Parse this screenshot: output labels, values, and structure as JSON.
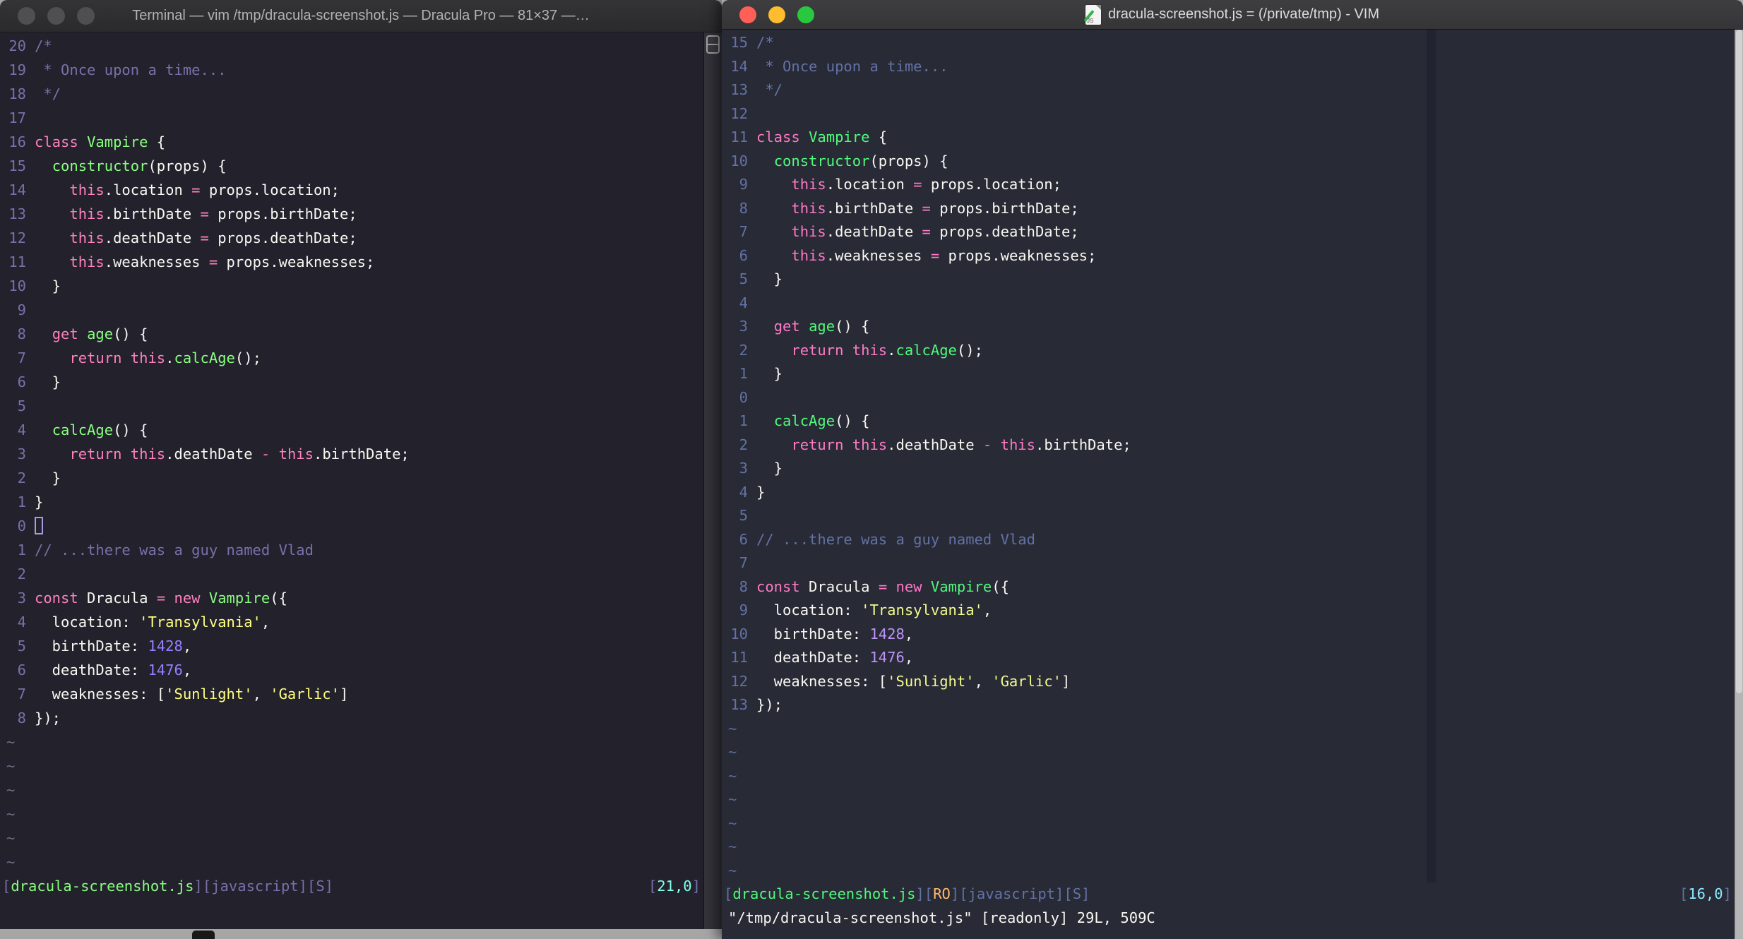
{
  "desktop": {
    "bg": "#a6a6a6"
  },
  "left_window": {
    "titlebar": {
      "title": "Terminal — vim /tmp/dracula-screenshot.js — Dracula Pro — 81×37 —…",
      "bg": "#2c2c2e",
      "text_color": "#b2b2b2",
      "lights": [
        "#4f4f52",
        "#4f4f52",
        "#4f4f52"
      ]
    },
    "theme": {
      "bg": "#22212c",
      "fg": "#f8f8f2",
      "comment": "#7970a9",
      "pink": "#ff80bf",
      "green": "#8aff80",
      "yellow": "#ffff80",
      "purple": "#9580ff",
      "cyan": "#80ffea",
      "orange": "#ffca80",
      "linenr": "#7970a9",
      "tilde": "#6f6a87",
      "cursor": "#a79de4"
    },
    "cursor_row": 21,
    "tildes": 6,
    "lines": [
      {
        "n": "20",
        "s": [
          [
            "/*",
            "comment"
          ]
        ]
      },
      {
        "n": "19",
        "s": [
          [
            " * Once upon a time...",
            "comment"
          ]
        ]
      },
      {
        "n": "18",
        "s": [
          [
            " */",
            "comment"
          ]
        ]
      },
      {
        "n": "17",
        "s": []
      },
      {
        "n": "16",
        "s": [
          [
            "class ",
            "pink"
          ],
          [
            "Vampire",
            "green"
          ],
          [
            " {",
            "fg"
          ]
        ]
      },
      {
        "n": "15",
        "s": [
          [
            "  ",
            "fg"
          ],
          [
            "constructor",
            "green"
          ],
          [
            "(props) {",
            "fg"
          ]
        ]
      },
      {
        "n": "14",
        "s": [
          [
            "    ",
            "fg"
          ],
          [
            "this",
            "pink"
          ],
          [
            ".location ",
            "fg"
          ],
          [
            "=",
            "pink"
          ],
          [
            " props.location;",
            "fg"
          ]
        ]
      },
      {
        "n": "13",
        "s": [
          [
            "    ",
            "fg"
          ],
          [
            "this",
            "pink"
          ],
          [
            ".birthDate ",
            "fg"
          ],
          [
            "=",
            "pink"
          ],
          [
            " props.birthDate;",
            "fg"
          ]
        ]
      },
      {
        "n": "12",
        "s": [
          [
            "    ",
            "fg"
          ],
          [
            "this",
            "pink"
          ],
          [
            ".deathDate ",
            "fg"
          ],
          [
            "=",
            "pink"
          ],
          [
            " props.deathDate;",
            "fg"
          ]
        ]
      },
      {
        "n": "11",
        "s": [
          [
            "    ",
            "fg"
          ],
          [
            "this",
            "pink"
          ],
          [
            ".weaknesses ",
            "fg"
          ],
          [
            "=",
            "pink"
          ],
          [
            " props.weaknesses;",
            "fg"
          ]
        ]
      },
      {
        "n": "10",
        "s": [
          [
            "  }",
            "fg"
          ]
        ]
      },
      {
        "n": "9",
        "s": []
      },
      {
        "n": "8",
        "s": [
          [
            "  ",
            "fg"
          ],
          [
            "get",
            "pink"
          ],
          [
            " ",
            "fg"
          ],
          [
            "age",
            "green"
          ],
          [
            "() {",
            "fg"
          ]
        ]
      },
      {
        "n": "7",
        "s": [
          [
            "    ",
            "fg"
          ],
          [
            "return",
            "pink"
          ],
          [
            " ",
            "fg"
          ],
          [
            "this",
            "pink"
          ],
          [
            ".",
            "fg"
          ],
          [
            "calcAge",
            "green"
          ],
          [
            "();",
            "fg"
          ]
        ]
      },
      {
        "n": "6",
        "s": [
          [
            "  }",
            "fg"
          ]
        ]
      },
      {
        "n": "5",
        "s": []
      },
      {
        "n": "4",
        "s": [
          [
            "  ",
            "fg"
          ],
          [
            "calcAge",
            "green"
          ],
          [
            "() {",
            "fg"
          ]
        ]
      },
      {
        "n": "3",
        "s": [
          [
            "    ",
            "fg"
          ],
          [
            "return",
            "pink"
          ],
          [
            " ",
            "fg"
          ],
          [
            "this",
            "pink"
          ],
          [
            ".deathDate ",
            "fg"
          ],
          [
            "-",
            "pink"
          ],
          [
            " ",
            "fg"
          ],
          [
            "this",
            "pink"
          ],
          [
            ".birthDate;",
            "fg"
          ]
        ]
      },
      {
        "n": "2",
        "s": [
          [
            "  }",
            "fg"
          ]
        ]
      },
      {
        "n": "1",
        "s": [
          [
            "}",
            "fg"
          ]
        ]
      },
      {
        "n": "0",
        "s": []
      },
      {
        "n": "1",
        "s": [
          [
            "// ...there was a guy named Vlad",
            "comment"
          ]
        ]
      },
      {
        "n": "2",
        "s": []
      },
      {
        "n": "3",
        "s": [
          [
            "const",
            "pink"
          ],
          [
            " Dracula ",
            "fg"
          ],
          [
            "=",
            "pink"
          ],
          [
            " ",
            "fg"
          ],
          [
            "new",
            "pink"
          ],
          [
            " ",
            "fg"
          ],
          [
            "Vampire",
            "green"
          ],
          [
            "({",
            "fg"
          ]
        ]
      },
      {
        "n": "4",
        "s": [
          [
            "  location: ",
            "fg"
          ],
          [
            "'Transylvania'",
            "yellow"
          ],
          [
            ",",
            "fg"
          ]
        ]
      },
      {
        "n": "5",
        "s": [
          [
            "  birthDate: ",
            "fg"
          ],
          [
            "1428",
            "purple"
          ],
          [
            ",",
            "fg"
          ]
        ]
      },
      {
        "n": "6",
        "s": [
          [
            "  deathDate: ",
            "fg"
          ],
          [
            "1476",
            "purple"
          ],
          [
            ",",
            "fg"
          ]
        ]
      },
      {
        "n": "7",
        "s": [
          [
            "  weaknesses: [",
            "fg"
          ],
          [
            "'Sunlight'",
            "yellow"
          ],
          [
            ", ",
            "fg"
          ],
          [
            "'Garlic'",
            "yellow"
          ],
          [
            "]",
            "fg"
          ]
        ]
      },
      {
        "n": "8",
        "s": [
          [
            "});",
            "fg"
          ]
        ]
      }
    ],
    "status_left": [
      [
        "[",
        "comment"
      ],
      [
        "dracula-screenshot.js",
        "green"
      ],
      [
        "][",
        "comment"
      ],
      [
        "javascript",
        "comment"
      ],
      [
        "][",
        "comment"
      ],
      [
        "S",
        "comment"
      ],
      [
        "]",
        "comment"
      ]
    ],
    "ruler": [
      [
        "[",
        "comment"
      ],
      [
        "21,0",
        "cyan"
      ],
      [
        "]",
        "comment"
      ]
    ],
    "cmdline": ""
  },
  "right_window": {
    "titlebar": {
      "title": "dracula-screenshot.js = (/private/tmp) - VIM",
      "bg": "#38383a",
      "text_color": "#dcdcdc",
      "lights": [
        "#ff5f57",
        "#febc2e",
        "#28c840"
      ],
      "doc_icon_label": "JS"
    },
    "theme": {
      "bg": "#282a36",
      "fg": "#f8f8f2",
      "comment": "#6272a4",
      "pink": "#ff79c6",
      "green": "#50fa7b",
      "yellow": "#f1fa8c",
      "purple": "#bd93f9",
      "cyan": "#8be9fd",
      "orange": "#ffb86c",
      "linenr": "#6272a4",
      "tilde": "#5b6a9a",
      "cursor": "#f8f8f2"
    },
    "cursor_row": 16,
    "tildes": 7,
    "lines": [
      {
        "n": "15",
        "s": [
          [
            "/*",
            "comment"
          ]
        ]
      },
      {
        "n": "14",
        "s": [
          [
            " * Once upon a time...",
            "comment"
          ]
        ]
      },
      {
        "n": "13",
        "s": [
          [
            " */",
            "comment"
          ]
        ]
      },
      {
        "n": "12",
        "s": []
      },
      {
        "n": "11",
        "s": [
          [
            "class ",
            "pink"
          ],
          [
            "Vampire",
            "green"
          ],
          [
            " {",
            "fg"
          ]
        ]
      },
      {
        "n": "10",
        "s": [
          [
            "  ",
            "fg"
          ],
          [
            "constructor",
            "green"
          ],
          [
            "(props) {",
            "fg"
          ]
        ]
      },
      {
        "n": "9",
        "s": [
          [
            "    ",
            "fg"
          ],
          [
            "this",
            "pink"
          ],
          [
            ".location ",
            "fg"
          ],
          [
            "=",
            "pink"
          ],
          [
            " props.location;",
            "fg"
          ]
        ]
      },
      {
        "n": "8",
        "s": [
          [
            "    ",
            "fg"
          ],
          [
            "this",
            "pink"
          ],
          [
            ".birthDate ",
            "fg"
          ],
          [
            "=",
            "pink"
          ],
          [
            " props.birthDate;",
            "fg"
          ]
        ]
      },
      {
        "n": "7",
        "s": [
          [
            "    ",
            "fg"
          ],
          [
            "this",
            "pink"
          ],
          [
            ".deathDate ",
            "fg"
          ],
          [
            "=",
            "pink"
          ],
          [
            " props.deathDate;",
            "fg"
          ]
        ]
      },
      {
        "n": "6",
        "s": [
          [
            "    ",
            "fg"
          ],
          [
            "this",
            "pink"
          ],
          [
            ".weaknesses ",
            "fg"
          ],
          [
            "=",
            "pink"
          ],
          [
            " props.weaknesses;",
            "fg"
          ]
        ]
      },
      {
        "n": "5",
        "s": [
          [
            "  }",
            "fg"
          ]
        ]
      },
      {
        "n": "4",
        "s": []
      },
      {
        "n": "3",
        "s": [
          [
            "  ",
            "fg"
          ],
          [
            "get",
            "pink"
          ],
          [
            " ",
            "fg"
          ],
          [
            "age",
            "green"
          ],
          [
            "() {",
            "fg"
          ]
        ]
      },
      {
        "n": "2",
        "s": [
          [
            "    ",
            "fg"
          ],
          [
            "return",
            "pink"
          ],
          [
            " ",
            "fg"
          ],
          [
            "this",
            "pink"
          ],
          [
            ".",
            "fg"
          ],
          [
            "calcAge",
            "green"
          ],
          [
            "();",
            "fg"
          ]
        ]
      },
      {
        "n": "1",
        "s": [
          [
            "  }",
            "fg"
          ]
        ]
      },
      {
        "n": "0",
        "s": []
      },
      {
        "n": "1",
        "s": [
          [
            "  ",
            "fg"
          ],
          [
            "calcAge",
            "green"
          ],
          [
            "() {",
            "fg"
          ]
        ]
      },
      {
        "n": "2",
        "s": [
          [
            "    ",
            "fg"
          ],
          [
            "return",
            "pink"
          ],
          [
            " ",
            "fg"
          ],
          [
            "this",
            "pink"
          ],
          [
            ".deathDate ",
            "fg"
          ],
          [
            "-",
            "pink"
          ],
          [
            " ",
            "fg"
          ],
          [
            "this",
            "pink"
          ],
          [
            ".birthDate;",
            "fg"
          ]
        ]
      },
      {
        "n": "3",
        "s": [
          [
            "  }",
            "fg"
          ]
        ]
      },
      {
        "n": "4",
        "s": [
          [
            "}",
            "fg"
          ]
        ]
      },
      {
        "n": "5",
        "s": []
      },
      {
        "n": "6",
        "s": [
          [
            "// ...there was a guy named Vlad",
            "comment"
          ]
        ]
      },
      {
        "n": "7",
        "s": []
      },
      {
        "n": "8",
        "s": [
          [
            "const",
            "pink"
          ],
          [
            " Dracula ",
            "fg"
          ],
          [
            "=",
            "pink"
          ],
          [
            " ",
            "fg"
          ],
          [
            "new",
            "pink"
          ],
          [
            " ",
            "fg"
          ],
          [
            "Vampire",
            "green"
          ],
          [
            "({",
            "fg"
          ]
        ]
      },
      {
        "n": "9",
        "s": [
          [
            "  location: ",
            "fg"
          ],
          [
            "'Transylvania'",
            "yellow"
          ],
          [
            ",",
            "fg"
          ]
        ]
      },
      {
        "n": "10",
        "s": [
          [
            "  birthDate: ",
            "fg"
          ],
          [
            "1428",
            "purple"
          ],
          [
            ",",
            "fg"
          ]
        ]
      },
      {
        "n": "11",
        "s": [
          [
            "  deathDate: ",
            "fg"
          ],
          [
            "1476",
            "purple"
          ],
          [
            ",",
            "fg"
          ]
        ]
      },
      {
        "n": "12",
        "s": [
          [
            "  weaknesses: [",
            "fg"
          ],
          [
            "'Sunlight'",
            "yellow"
          ],
          [
            ", ",
            "fg"
          ],
          [
            "'Garlic'",
            "yellow"
          ],
          [
            "]",
            "fg"
          ]
        ]
      },
      {
        "n": "13",
        "s": [
          [
            "});",
            "fg"
          ]
        ]
      }
    ],
    "status_left": [
      [
        "[",
        "comment"
      ],
      [
        "dracula-screenshot.js",
        "green"
      ],
      [
        "][",
        "comment"
      ],
      [
        "RO",
        "orange"
      ],
      [
        "][",
        "comment"
      ],
      [
        "javascript",
        "comment"
      ],
      [
        "][",
        "comment"
      ],
      [
        "S",
        "comment"
      ],
      [
        "]",
        "comment"
      ]
    ],
    "ruler": [
      [
        "[",
        "comment"
      ],
      [
        "16,0",
        "cyan"
      ],
      [
        "]",
        "comment"
      ]
    ],
    "cmdline": "\"/tmp/dracula-screenshot.js\" [readonly] 29L, 509C"
  }
}
